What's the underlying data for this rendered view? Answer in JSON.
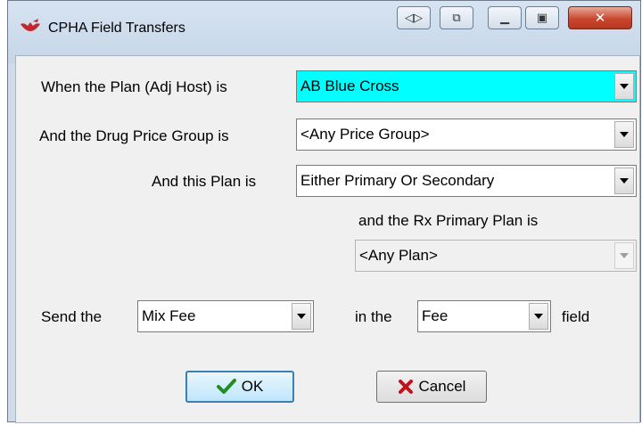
{
  "window": {
    "title": "CPHA Field Transfers",
    "title_buttons": [
      "resize-icon",
      "restore-icon",
      "minimize-icon",
      "maximize-icon",
      "close-icon"
    ]
  },
  "rows": {
    "plan_label": "When the Plan (Adj Host) is",
    "plan_value": "AB Blue Cross",
    "plan_highlight_color": "#00ffff",
    "price_group_label": "And the Drug Price Group is",
    "price_group_value": "<Any Price Group>",
    "plan_type_label": "And this Plan is",
    "plan_type_value": "Either Primary Or Secondary",
    "rx_primary_label": "and the Rx Primary Plan is",
    "rx_primary_value": "<Any Plan>"
  },
  "send": {
    "send_label": "Send the",
    "source_value": "Mix Fee",
    "in_label": "in the",
    "target_value": "Fee",
    "field_label": "field"
  },
  "buttons": {
    "ok_label": "OK",
    "cancel_label": "Cancel"
  }
}
